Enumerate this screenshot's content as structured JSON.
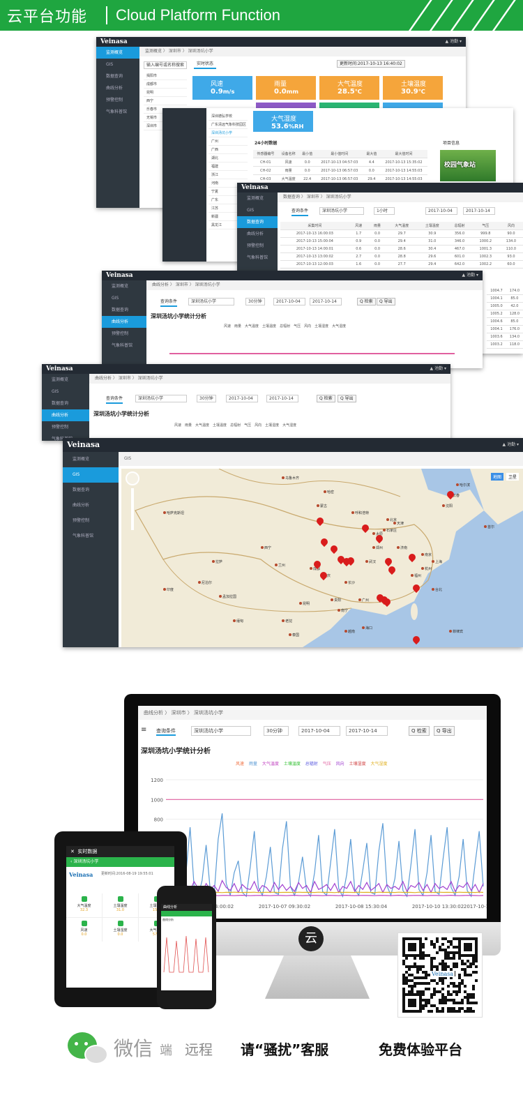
{
  "banner": {
    "title_cn": "云平台功能",
    "title_en": "Cloud Platform Function"
  },
  "brand": "Veinasa",
  "user_menu": "▲ 池勤 ▾",
  "nav": [
    "监测概览",
    "GIS",
    "数据查询",
    "曲线分析",
    "预警控制",
    "气象科普馆"
  ],
  "realtime": {
    "breadcrumb": "监测概览 〉 深圳市 〉 深圳汤坑小学",
    "search_placeholder": "输入编号或名称搜索",
    "tab": "实时状态",
    "update_time": "更新时间:2017-10-13 16:40:02",
    "cities": [
      "揭阳市",
      "成都市",
      "昆明",
      "西宁",
      "乐春市",
      "无锡市",
      "深圳市"
    ],
    "cards": [
      {
        "name": "风速",
        "value": "0.9",
        "unit": "m/s",
        "color": "#3fa9e8"
      },
      {
        "name": "雨量",
        "value": "0.0",
        "unit": "mm",
        "color": "#f5a53b"
      },
      {
        "name": "大气温度",
        "value": "28.5",
        "unit": "℃",
        "color": "#f5a53b"
      },
      {
        "name": "土壤温度",
        "value": "30.9",
        "unit": "℃",
        "color": "#f5a53b"
      }
    ]
  },
  "window2": {
    "schools": [
      "深圳德弘学校",
      "广东清远气象科技园区",
      "深圳汤坑小学",
      "广州",
      "广西",
      "湖北",
      "福建",
      "浙江",
      "河南",
      "宁夏",
      "广东",
      "江苏",
      "新疆",
      "黑龙江"
    ],
    "card": {
      "name": "大气湿度",
      "value": "53.6",
      "unit": "%RH"
    },
    "table_title": "24小时数据",
    "headers": [
      "传感器编号",
      "设备名称",
      "最小值",
      "最小值时间",
      "最大值",
      "最大值时间"
    ],
    "rows": [
      [
        "CH-01",
        "风速",
        "0.0",
        "2017-10-13 04:57:03",
        "4.4",
        "2017-10-13 15:35:02"
      ],
      [
        "CH-02",
        "雨量",
        "0.0",
        "2017-10-13 06:57:03",
        "0.0",
        "2017-10-13 14:55:03"
      ],
      [
        "CH-03",
        "大气温度",
        "22.4",
        "2017-10-13 06:57:03",
        "29.4",
        "2017-10-13 14:55:03"
      ]
    ],
    "side_title": "项目信息",
    "photo_caption": "校园气象站"
  },
  "query": {
    "breadcrumb": "数据查询 〉 深圳市 〉 深圳汤坑小学",
    "tab": "查询条件",
    "station": "深圳汤坑小学",
    "interval": "1小时",
    "from": "2017-10-04",
    "to": "2017-10-14",
    "headers": [
      "采集时间",
      "风速",
      "雨量",
      "大气温度",
      "土壤温度",
      "总辐射",
      "气压",
      "风向"
    ],
    "rows": [
      [
        "2017-10-13 16:00:03",
        "1.7",
        "0.0",
        "29.7",
        "30.9",
        "356.0",
        "999.8",
        "90.0"
      ],
      [
        "2017-10-13 15:00:04",
        "0.9",
        "0.0",
        "29.4",
        "31.0",
        "346.0",
        "1000.2",
        "134.0"
      ],
      [
        "2017-10-13 14:00:01",
        "0.6",
        "0.0",
        "28.6",
        "30.4",
        "467.0",
        "1001.3",
        "110.0"
      ],
      [
        "2017-10-13 13:00:02",
        "2.7",
        "0.0",
        "28.8",
        "29.6",
        "601.0",
        "1002.3",
        "93.0"
      ],
      [
        "2017-10-13 12:00:03",
        "1.6",
        "0.0",
        "27.7",
        "29.4",
        "642.0",
        "1002.2",
        "60.0"
      ]
    ],
    "extra": [
      [
        "1004.7",
        "174.0"
      ],
      [
        "1004.1",
        "85.0"
      ],
      [
        "1005.0",
        "42.0"
      ],
      [
        "1005.2",
        "128.0"
      ],
      [
        "1004.6",
        "85.0"
      ],
      [
        "1004.1",
        "176.0"
      ],
      [
        "1003.6",
        "134.0"
      ],
      [
        "1003.2",
        "118.0"
      ],
      [
        "1001.7",
        "96.0"
      ],
      [
        "1001.3",
        "45.0"
      ]
    ]
  },
  "curve": {
    "breadcrumb": "曲线分析 〉 深圳市 〉 深圳汤坑小学",
    "tab": "查询条件",
    "station": "深圳汤坑小学",
    "interval": "30分钟",
    "from": "2017-10-04",
    "to": "2017-10-14",
    "search_btn": "Q 检索",
    "export_btn": "Q 导出",
    "title": "深圳汤坑小学统计分析",
    "legend": [
      "风速",
      "雨量",
      "大气温度",
      "土壤温度",
      "总辐射",
      "气压",
      "风向",
      "土壤湿度",
      "大气湿度"
    ],
    "legend_colors": [
      "#f07040",
      "#5b9bd5",
      "#c040c0",
      "#30c030",
      "#6060e0",
      "#e060a0",
      "#a040d0",
      "#d04040",
      "#e0b020"
    ]
  },
  "gis": {
    "tab": "GIS",
    "map_btns": [
      "地图",
      "卫星"
    ],
    "labels": [
      "乌鲁木齐",
      "哈密",
      "西宁",
      "兰州",
      "拉萨",
      "成都",
      "重庆",
      "昆明",
      "贵阳",
      "南宁",
      "广州",
      "海口",
      "长沙",
      "武汉",
      "郑州",
      "北京",
      "天津",
      "呼和浩特",
      "太原",
      "石家庄",
      "济南",
      "南京",
      "上海",
      "杭州",
      "福州",
      "台北",
      "沈阳",
      "长春",
      "哈尔滨",
      "首尔",
      "蒙古",
      "哈萨克斯坦",
      "印度",
      "缅甸",
      "老挝",
      "越南",
      "泰国",
      "菲律宾",
      "尼泊尔",
      "孟加拉国"
    ]
  },
  "desktop_chart": {
    "breadcrumb": "曲线分析 〉 深圳市 〉 深圳汤坑小学",
    "tab": "查询条件",
    "station": "深圳汤坑小学",
    "interval": "30分钟",
    "from": "2017-10-04",
    "to": "2017-10-14",
    "search_btn": "Q 检索",
    "export_btn": "Q 导出",
    "title": "深圳汤坑小学统计分析",
    "legend": [
      "风速",
      "雨量",
      "大气温度",
      "土壤温度",
      "总辐射",
      "气压",
      "风向",
      "土壤湿度",
      "大气湿度"
    ]
  },
  "chart_data": {
    "type": "line",
    "title": "深圳汤坑小学统计分析",
    "yticks": [
      1200,
      1000,
      800
    ],
    "xticks": [
      "2017-10-05 14:00:02",
      "2017-10-07 09:30:02",
      "2017-10-08 15:30:04",
      "2017-10-10 13:30:02",
      "2017-10-1"
    ],
    "ylim": [
      0,
      1200
    ],
    "series": [
      {
        "name": "气压",
        "color": "#e060a0",
        "values": [
          1000,
          1000,
          1000,
          1000,
          1000,
          1000,
          1000,
          1000,
          1000,
          1000,
          1000,
          1000,
          1000,
          1000,
          1000,
          1000,
          1000,
          1000,
          1000,
          1000,
          1000,
          1000,
          1000,
          1000,
          1000,
          1000,
          1000,
          1000,
          1000,
          1000,
          1000,
          1000,
          1000,
          1000,
          1000,
          1000,
          1000,
          1000,
          1000,
          1000,
          1000,
          1000,
          1000,
          1000,
          1000,
          1000,
          1000,
          1000,
          1000,
          1000,
          1000,
          1000,
          1000,
          1000,
          1000,
          1000,
          1000,
          1000,
          1000,
          1000,
          1000,
          1000,
          1000,
          1000,
          1000,
          1000,
          1000,
          1000,
          1000,
          1000,
          1000,
          1000,
          1000,
          1000,
          1000,
          1000,
          1000,
          1000,
          1000,
          1000
        ]
      },
      {
        "name": "总辐射",
        "color": "#5b9bd5",
        "values": [
          40,
          200,
          620,
          80,
          30,
          260,
          720,
          120,
          20,
          180,
          540,
          90,
          40,
          600,
          860,
          150,
          30,
          260,
          380,
          60,
          20,
          320,
          680,
          110,
          30,
          220,
          520,
          60,
          40,
          500,
          780,
          120,
          30,
          160,
          420,
          80,
          20,
          260,
          640,
          70,
          30,
          360,
          700,
          100,
          20,
          240,
          600,
          90,
          30,
          280,
          560,
          60,
          40,
          480,
          760,
          130,
          30,
          200,
          580,
          80,
          20,
          340,
          700,
          90,
          30,
          260,
          640,
          70,
          40,
          400,
          720,
          110,
          30,
          220,
          600,
          80,
          20,
          360,
          680,
          120
        ]
      },
      {
        "name": "风向",
        "color": "#a040d0",
        "values": [
          120,
          90,
          160,
          60,
          110,
          140,
          80,
          170,
          100,
          60,
          150,
          90,
          130,
          70,
          180,
          110,
          80,
          150,
          60,
          140,
          100,
          90,
          170,
          70,
          130,
          110,
          60,
          160,
          90,
          140,
          80,
          120,
          70,
          160,
          100,
          130,
          60,
          170,
          90,
          110,
          140,
          80,
          150,
          60,
          120,
          100,
          170,
          70,
          130,
          90,
          160,
          80,
          110,
          150,
          60,
          140,
          100,
          120,
          90,
          170,
          70,
          130,
          110,
          160,
          80,
          140,
          60,
          150,
          100,
          120,
          90,
          170,
          70,
          130,
          110,
          160,
          80,
          140,
          60,
          150
        ]
      },
      {
        "name": "大气湿度",
        "color": "#e0b020",
        "values": [
          60,
          62,
          58,
          60,
          64,
          60,
          58,
          62,
          60,
          61,
          59,
          60,
          62,
          60,
          58,
          61,
          60,
          62,
          60,
          59,
          61,
          60,
          62,
          58,
          60,
          61,
          60,
          62,
          59,
          60,
          61,
          60,
          58,
          62,
          60,
          61,
          60,
          59,
          62,
          60,
          61,
          60,
          58,
          62,
          60,
          61,
          60,
          59,
          62,
          60,
          61,
          60,
          58,
          62,
          60,
          61,
          60,
          59,
          62,
          60,
          61,
          60,
          58,
          62,
          60,
          61,
          60,
          59,
          62,
          60,
          61,
          60,
          58,
          62,
          60,
          61,
          60,
          59,
          62,
          60
        ]
      },
      {
        "name": "大气温度",
        "color": "#c040c0",
        "values": [
          28,
          29,
          30,
          28,
          27,
          29,
          31,
          28,
          27,
          28,
          30,
          29,
          28,
          27,
          29,
          30,
          28,
          27,
          29,
          31,
          28,
          27,
          28,
          30,
          29,
          28,
          27,
          29,
          30,
          28,
          27,
          29,
          31,
          28,
          27,
          28,
          30,
          29,
          28,
          27,
          29,
          30,
          28,
          27,
          29,
          31,
          28,
          27,
          28,
          30,
          29,
          28,
          27,
          29,
          30,
          28,
          27,
          29,
          31,
          28,
          27,
          28,
          30,
          29,
          28,
          27,
          29,
          30,
          28,
          27,
          29,
          31,
          28,
          27,
          28,
          30,
          29,
          28,
          27,
          29
        ]
      }
    ]
  },
  "tablet": {
    "title": "实时数据",
    "station": "深圳汤坑小学",
    "brand": "Veinasa",
    "update": "更新时间:2016-08-19 19:55:01",
    "cells": [
      [
        "大气温度",
        "32.3"
      ],
      [
        "土壤温度",
        "31.0"
      ],
      [
        "土壤湿度",
        "15.0"
      ],
      [
        "风速",
        "0.0"
      ],
      [
        "土壤湿度",
        "0.0"
      ],
      [
        "大气湿度",
        "57.0"
      ]
    ]
  },
  "phone": {
    "title": "曲线分析",
    "tab": "曲线分析"
  },
  "qr": {
    "brand": "Veinasa"
  },
  "bottom": {
    "wechat": "微信",
    "duan": "端",
    "remote": "远程",
    "slogan": "请“骚扰”客服",
    "free": "免费体验平台"
  },
  "monitor_logo": "云"
}
